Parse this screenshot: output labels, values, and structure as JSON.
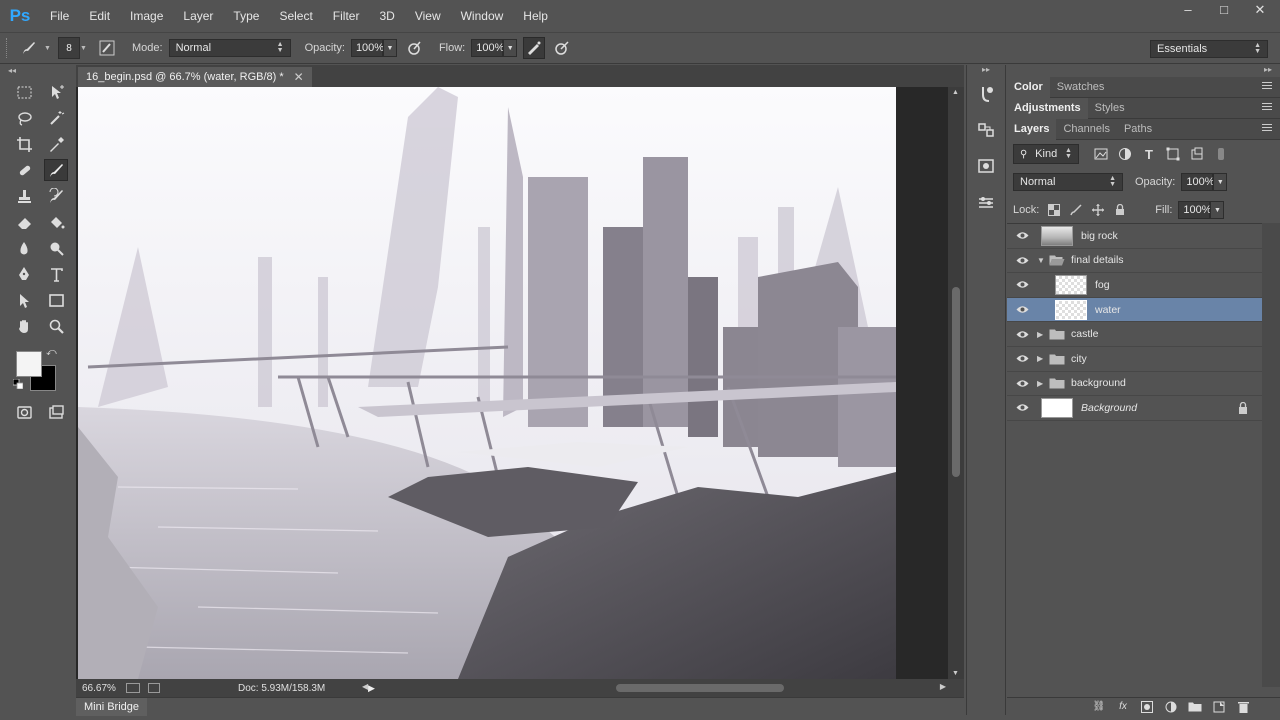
{
  "app": {
    "logo": "Ps",
    "accent": "#31a8ff"
  },
  "menu": [
    "File",
    "Edit",
    "Image",
    "Layer",
    "Type",
    "Select",
    "Filter",
    "3D",
    "View",
    "Window",
    "Help"
  ],
  "window_controls": {
    "minimize": "–",
    "maximize": "□",
    "close": "✕"
  },
  "options": {
    "brush_size": "8",
    "mode_label": "Mode:",
    "mode_value": "Normal",
    "opacity_label": "Opacity:",
    "opacity_value": "100%",
    "flow_label": "Flow:",
    "flow_value": "100%",
    "workspace": "Essentials"
  },
  "document": {
    "tab_title": "16_begin.psd @ 66.7% (water, RGB/8) *",
    "zoom": "66.67%",
    "doc_size": "Doc: 5.93M/158.3M"
  },
  "mini_bridge": "Mini Bridge",
  "panels": {
    "group1_tabs": [
      "Color",
      "Swatches"
    ],
    "group2_tabs": [
      "Adjustments",
      "Styles"
    ],
    "group3_tabs": [
      "Layers",
      "Channels",
      "Paths"
    ],
    "kind_label": "Kind",
    "blend_mode": "Normal",
    "opacity_label": "Opacity:",
    "opacity_value": "100%",
    "lock_label": "Lock:",
    "fill_label": "Fill:",
    "fill_value": "100%"
  },
  "layers": [
    {
      "name": "big rock",
      "type": "layer",
      "thumb": "rock",
      "indent": 0,
      "selected": false
    },
    {
      "name": "final details",
      "type": "group",
      "expanded": true,
      "indent": 0,
      "selected": false
    },
    {
      "name": "fog",
      "type": "layer",
      "thumb": "checker",
      "indent": 1,
      "selected": false
    },
    {
      "name": "water",
      "type": "layer",
      "thumb": "checker",
      "indent": 1,
      "selected": true
    },
    {
      "name": "castle",
      "type": "group",
      "expanded": false,
      "indent": 0,
      "selected": false
    },
    {
      "name": "city",
      "type": "group",
      "expanded": false,
      "indent": 0,
      "selected": false
    },
    {
      "name": "background",
      "type": "group",
      "expanded": false,
      "indent": 0,
      "selected": false
    },
    {
      "name": "Background",
      "type": "layer",
      "thumb": "white",
      "indent": 0,
      "selected": false,
      "locked": true,
      "italic": true
    }
  ]
}
